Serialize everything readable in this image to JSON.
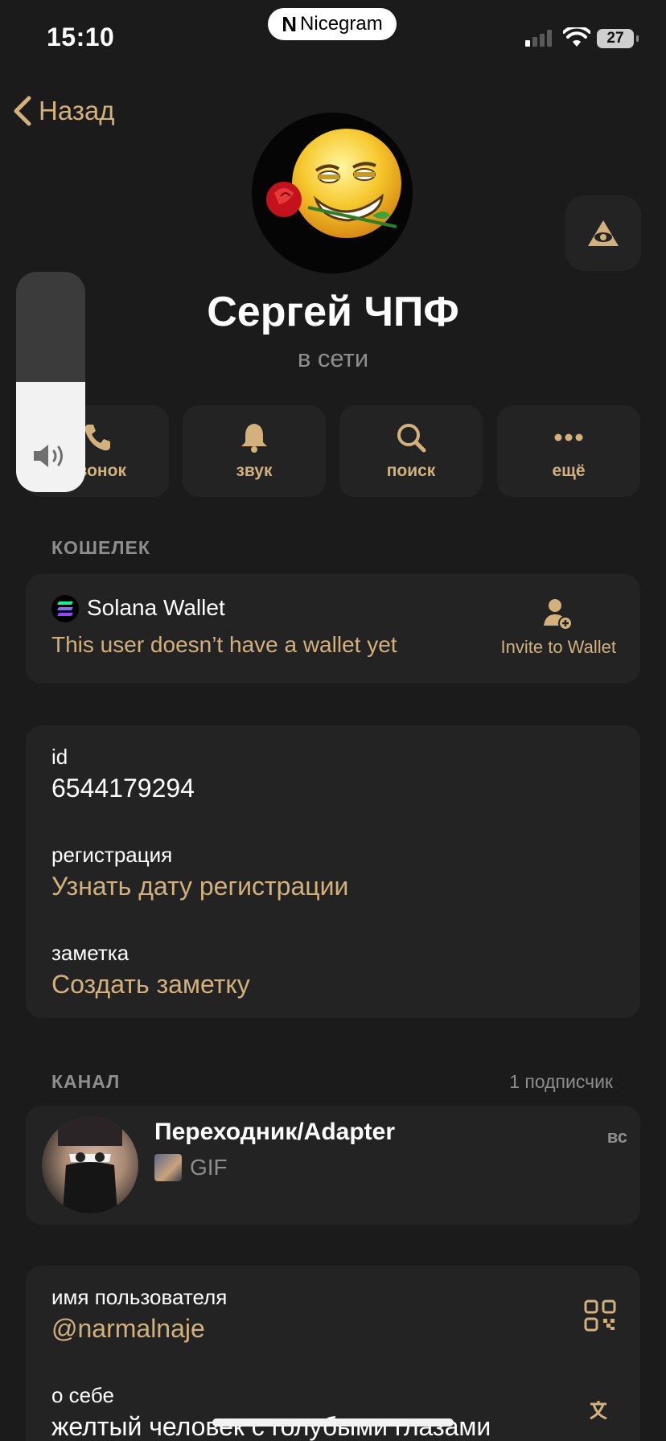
{
  "status_bar": {
    "time": "15:10",
    "app_badge": "Nicegram",
    "battery": "27"
  },
  "nav": {
    "back_label": "Назад"
  },
  "profile": {
    "name": "Сергей ЧПФ",
    "status": "в сети"
  },
  "actions": [
    {
      "label": "звонок",
      "icon": "phone-icon"
    },
    {
      "label": "звук",
      "icon": "bell-icon"
    },
    {
      "label": "поиск",
      "icon": "search-icon"
    },
    {
      "label": "ещё",
      "icon": "more-icon"
    }
  ],
  "volume": {
    "level": 0.5
  },
  "wallet": {
    "header": "КОШЕЛЕК",
    "title": "Solana Wallet",
    "subtitle": "This user doesn’t have a wallet yet",
    "invite_label": "Invite to Wallet"
  },
  "info": {
    "id_label": "id",
    "id_value": "6544179294",
    "reg_label": "регистрация",
    "reg_value": "Узнать дату регистрации",
    "note_label": "заметка",
    "note_value": "Создать заметку"
  },
  "channel": {
    "header": "КАНАЛ",
    "subscribers": "1 подписчик",
    "name": "Переходник/Adapter",
    "date": "вс",
    "preview": "GIF"
  },
  "user": {
    "username_label": "имя пользователя",
    "username_value": "@narmalnaje",
    "bio_label": "о себе",
    "bio_value": "желтый человек с голубыми глазами"
  },
  "colors": {
    "accent": "#d2b17c",
    "background": "#1b1b1b",
    "card": "#232323",
    "secondary_text": "#8e8e8e"
  }
}
